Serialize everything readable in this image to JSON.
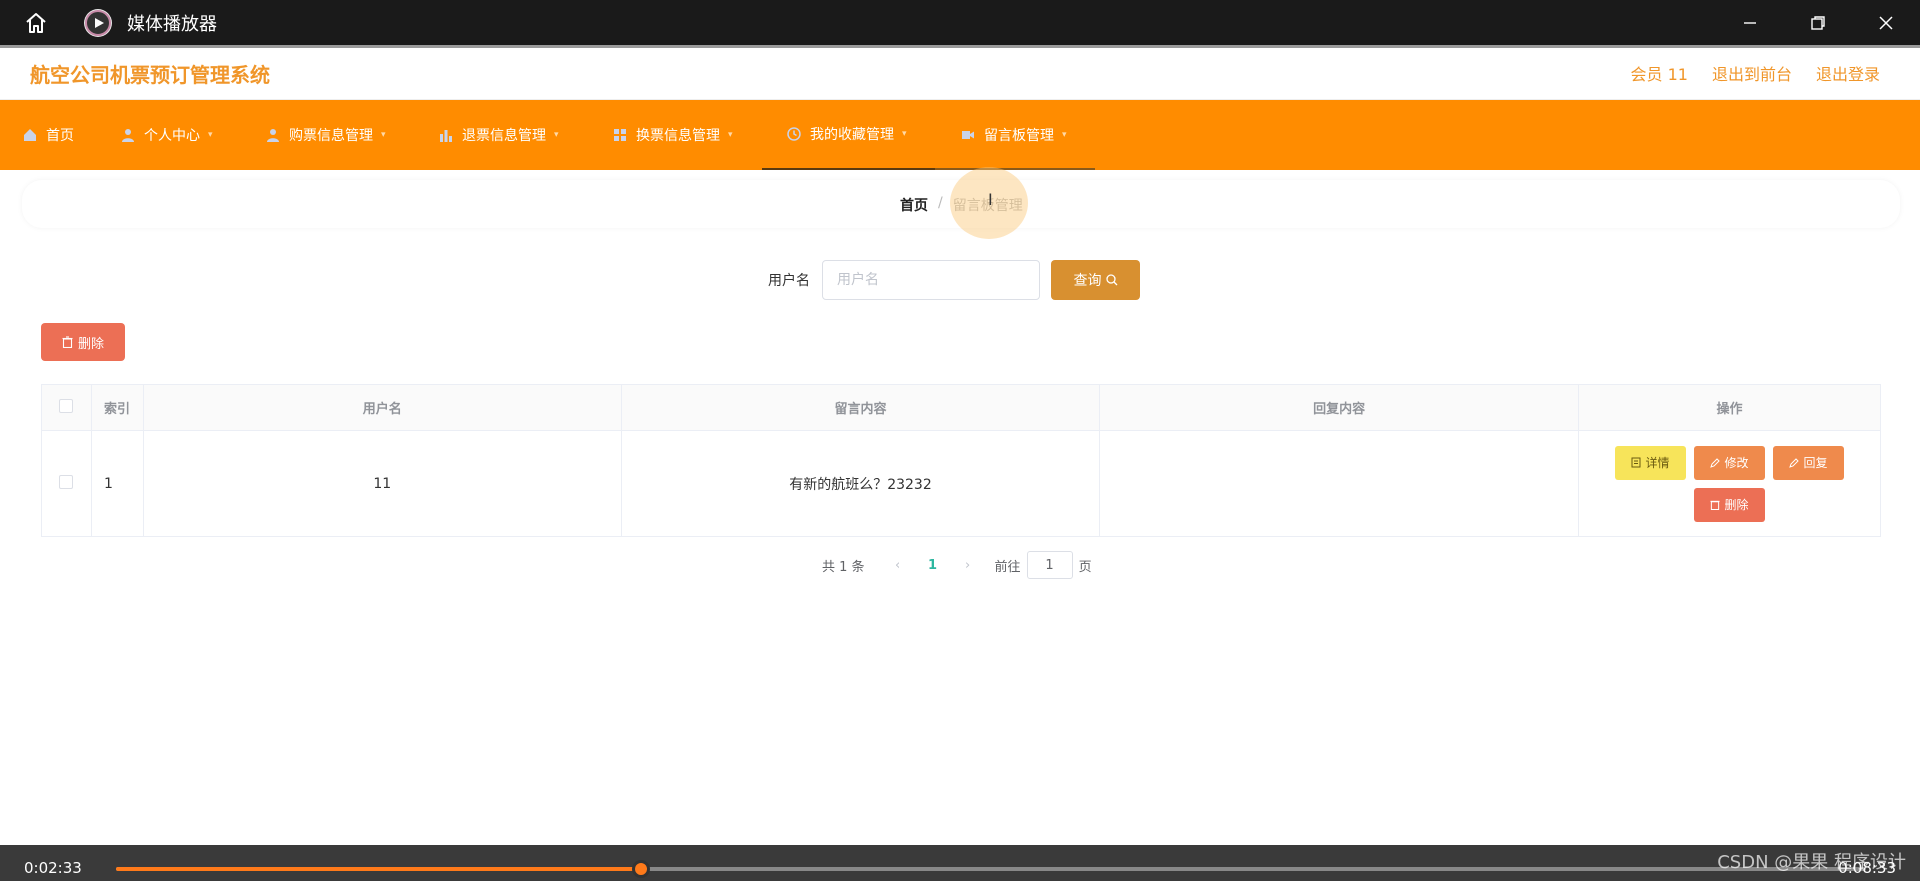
{
  "titlebar": {
    "app_title": "媒体播放器",
    "icons": [
      "home-icon",
      "play-app-icon",
      "minimize-icon",
      "restore-icon",
      "close-icon"
    ]
  },
  "header": {
    "brand": "航空公司机票预订管理系统",
    "links": [
      "会员 11",
      "退出到前台",
      "退出登录"
    ],
    "accent_color": "#f0962a"
  },
  "nav": {
    "items": [
      {
        "label": "首页",
        "icon": "home-icon"
      },
      {
        "label": "个人中心",
        "icon": "user-icon"
      },
      {
        "label": "购票信息管理",
        "icon": "user-icon"
      },
      {
        "label": "退票信息管理",
        "icon": "bar-chart-icon"
      },
      {
        "label": "换票信息管理",
        "icon": "grid-icon"
      },
      {
        "label": "我的收藏管理",
        "icon": "clock-icon"
      },
      {
        "label": "留言板管理",
        "icon": "video-icon"
      }
    ],
    "active_index": 5,
    "bg_color": "#ff8c00"
  },
  "breadcrumb": {
    "home": "首页",
    "separator": "/",
    "current": "留言板管理"
  },
  "search": {
    "label": "用户名",
    "placeholder": "用户名",
    "value": "",
    "button": "查询"
  },
  "toolbar": {
    "delete_label": "删除"
  },
  "table": {
    "headers": [
      "索引",
      "用户名",
      "留言内容",
      "回复内容",
      "操作"
    ],
    "rows": [
      {
        "index": "1",
        "username": "11",
        "message": "有新的航班么？23232",
        "reply": ""
      }
    ],
    "actions": {
      "detail": "详情",
      "edit": "修改",
      "reply": "回复",
      "delete": "删除"
    }
  },
  "pager": {
    "total": "共 1 条",
    "current_page": "1",
    "goto_label": "前往",
    "goto_value": "1",
    "page_suffix": "页"
  },
  "player": {
    "current_time": "0:02:33",
    "duration": "0:08:33",
    "progress": 0.3
  },
  "watermark": "CSDN @果果 程序设计"
}
